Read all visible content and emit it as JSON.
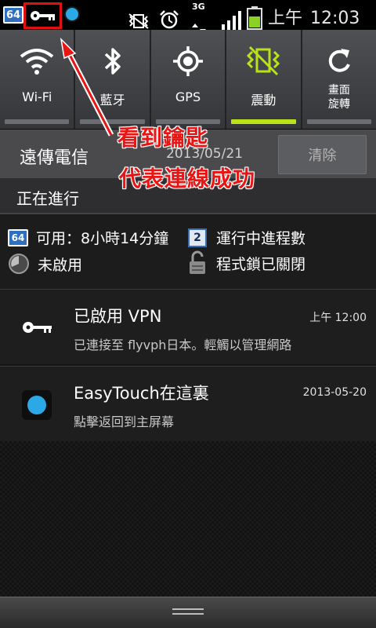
{
  "status_bar": {
    "battery_badge": "64",
    "network_type": "3G",
    "time_period": "上午",
    "time": "12:03"
  },
  "quick_toggles": [
    {
      "label": "Wi-Fi",
      "icon": "wifi-icon",
      "active": false
    },
    {
      "label": "藍牙",
      "icon": "bluetooth-icon",
      "active": false
    },
    {
      "label": "GPS",
      "icon": "gps-icon",
      "active": false
    },
    {
      "label": "震動",
      "icon": "vibrate-icon",
      "active": true
    },
    {
      "label": "畫面",
      "label2": "旋轉",
      "icon": "rotate-icon",
      "active": false
    }
  ],
  "carrier": {
    "name": "遠傳電信",
    "date": "2013/05/21",
    "clear_label": "清除"
  },
  "ongoing": {
    "header": "正在進行",
    "items": [
      {
        "badge": "64",
        "text": "可用：8小時14分鐘"
      },
      {
        "badge": "2",
        "text": "運行中進程數"
      },
      {
        "text": "未啟用"
      },
      {
        "text": "程式鎖已關閉"
      }
    ]
  },
  "notifications": [
    {
      "title": "已啟用 VPN",
      "subtitle": "已連接至 flyvph日本。輕觸以管理網路",
      "time": "上午 12:00",
      "icon": "key-icon"
    },
    {
      "title": "EasyTouch在這裏",
      "subtitle": "點擊返回到主屏幕",
      "time": "2013-05-20",
      "icon": "easytouch-icon"
    }
  ],
  "annotation": {
    "line1": "看到鑰匙",
    "line2": "代表連線成功",
    "color": "#e81515"
  }
}
